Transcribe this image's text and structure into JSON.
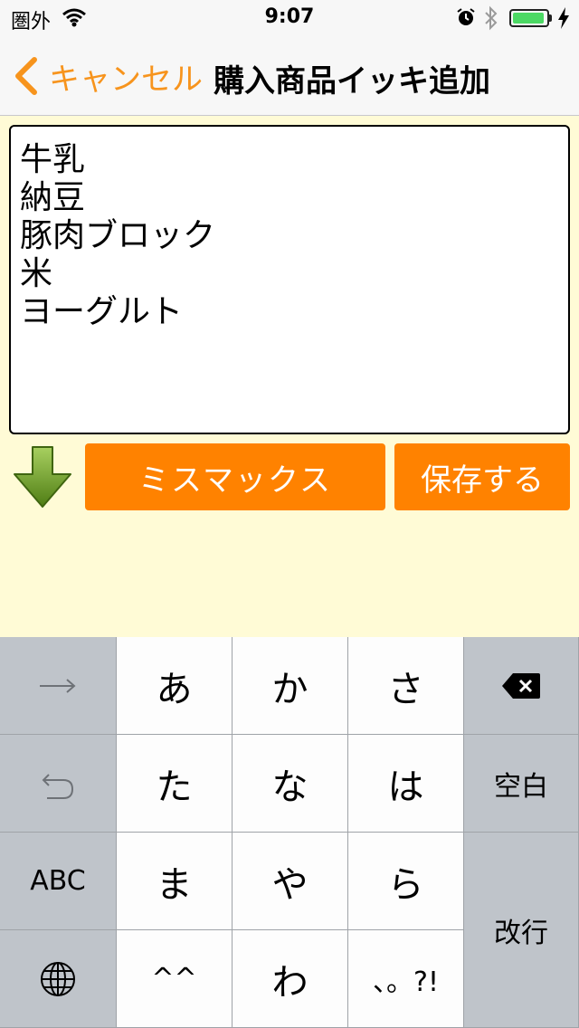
{
  "status_bar": {
    "carrier": "圏外",
    "time": "9:07",
    "battery_level": 0.95
  },
  "nav": {
    "back_label": "キャンセル",
    "title": "購入商品イッキ追加"
  },
  "editor": {
    "lines": [
      "牛乳",
      "納豆",
      "豚肉ブロック",
      "米",
      "ヨーグルト"
    ]
  },
  "actions": {
    "missmax_label": "ミスマックス",
    "save_label": "保存する"
  },
  "keyboard": {
    "row1": [
      "あ",
      "か",
      "さ"
    ],
    "row2": [
      "た",
      "な",
      "は"
    ],
    "row3": [
      "ま",
      "や",
      "ら"
    ],
    "row4": [
      "^^",
      "わ",
      "、。?!"
    ],
    "abc_label": "ABC",
    "space_label": "空白",
    "return_label": "改行"
  },
  "colors": {
    "accent": "#f7941d",
    "button": "#ff8200",
    "background": "#fffbd6"
  }
}
